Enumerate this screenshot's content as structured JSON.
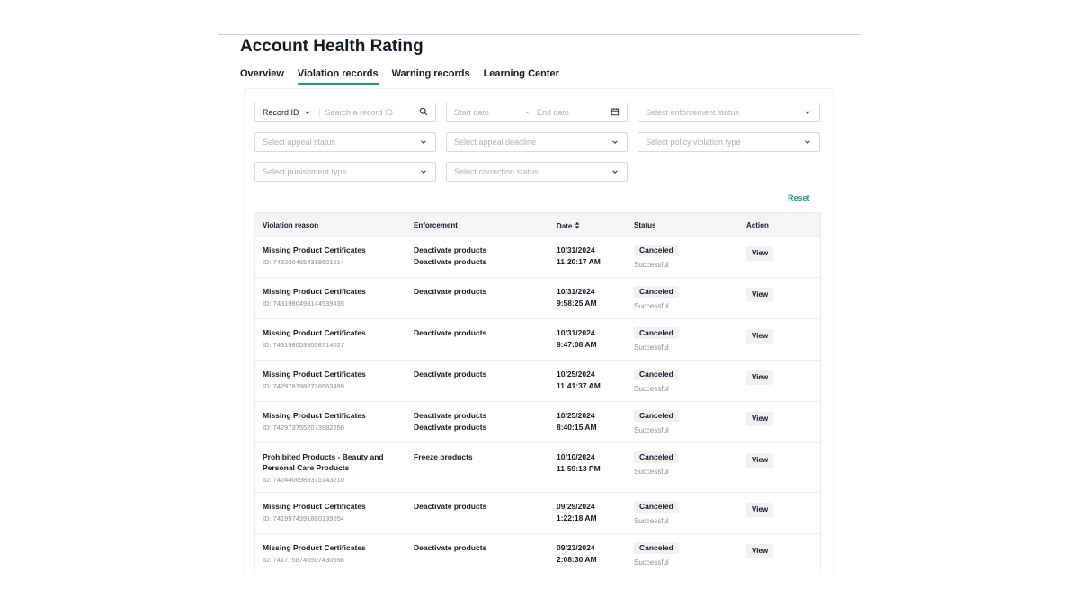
{
  "page": {
    "title": "Account Health Rating",
    "tabs": [
      {
        "label": "Overview",
        "active": false
      },
      {
        "label": "Violation records",
        "active": true
      },
      {
        "label": "Warning records",
        "active": false
      },
      {
        "label": "Learning Center",
        "active": false
      }
    ]
  },
  "filters": {
    "record_id_label": "Record ID",
    "search_placeholder": "Search a record ID",
    "start_date_placeholder": "Start date",
    "date_separator": "-",
    "end_date_placeholder": "End date",
    "enforcement_status_placeholder": "Select enforcement status",
    "appeal_status_placeholder": "Select appeal status",
    "appeal_deadline_placeholder": "Select appeal deadline",
    "policy_violation_placeholder": "Select policy violation type",
    "punishment_type_placeholder": "Select punishment type",
    "correction_status_placeholder": "Select correction status",
    "reset_label": "Reset"
  },
  "table": {
    "headers": {
      "reason": "Violation reason",
      "enforcement": "Enforcement",
      "date": "Date",
      "status": "Status",
      "action": "Action"
    },
    "rows": [
      {
        "reason": "Missing Product Certificates",
        "id": "ID: 7432004654319501614",
        "enforcement": [
          "Deactivate products",
          "Deactivate products"
        ],
        "date": "10/31/2024",
        "time": "11:20:17 AM",
        "status": "Canceled",
        "sub_status": "Successful",
        "action": "View"
      },
      {
        "reason": "Missing Product Certificates",
        "id": "ID: 7431980493144539435",
        "enforcement": [
          "Deactivate products"
        ],
        "date": "10/31/2024",
        "time": "9:58:25 AM",
        "status": "Canceled",
        "sub_status": "Successful",
        "action": "View"
      },
      {
        "reason": "Missing Product Certificates",
        "id": "ID: 7431980033008714027",
        "enforcement": [
          "Deactivate products"
        ],
        "date": "10/31/2024",
        "time": "9:47:08 AM",
        "status": "Canceled",
        "sub_status": "Successful",
        "action": "View"
      },
      {
        "reason": "Missing Product Certificates",
        "id": "ID: 7429781982726963499",
        "enforcement": [
          "Deactivate products"
        ],
        "date": "10/25/2024",
        "time": "11:41:37 AM",
        "status": "Canceled",
        "sub_status": "Successful",
        "action": "View"
      },
      {
        "reason": "Missing Product Certificates",
        "id": "ID: 7429737552073982250",
        "enforcement": [
          "Deactivate products",
          "Deactivate products"
        ],
        "date": "10/25/2024",
        "time": "8:40:15 AM",
        "status": "Canceled",
        "sub_status": "Successful",
        "action": "View"
      },
      {
        "reason": "Prohibited Products - Beauty and Personal Care Products",
        "id": "ID: 7424406983375143210",
        "enforcement": [
          "Freeze products"
        ],
        "date": "10/10/2024",
        "time": "11:59:13 PM",
        "status": "Canceled",
        "sub_status": "Successful",
        "action": "View"
      },
      {
        "reason": "Missing Product Certificates",
        "id": "ID: 7419974391880139054",
        "enforcement": [
          "Deactivate products"
        ],
        "date": "09/29/2024",
        "time": "1:22:18 AM",
        "status": "Canceled",
        "sub_status": "Successful",
        "action": "View"
      },
      {
        "reason": "Missing Product Certificates",
        "id": "ID: 7417758745507430698",
        "enforcement": [
          "Deactivate products"
        ],
        "date": "09/23/2024",
        "time": "2:08:30 AM",
        "status": "Canceled",
        "sub_status": "Successful",
        "action": "View"
      }
    ]
  },
  "icons": {
    "search": "search-icon",
    "calendar": "calendar-icon",
    "chevron": "chevron-down-icon",
    "sort": "sort-icon"
  },
  "colors": {
    "accent": "#1a9c93"
  }
}
